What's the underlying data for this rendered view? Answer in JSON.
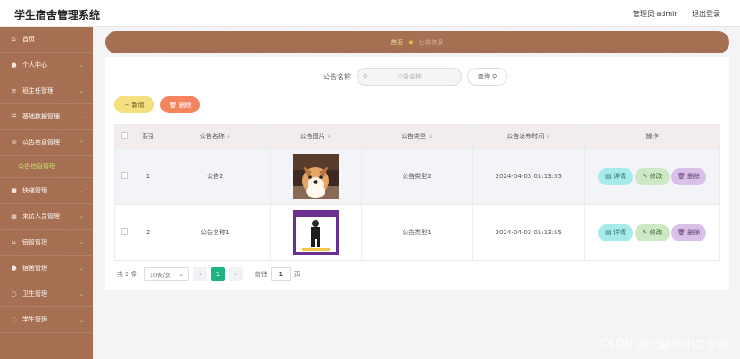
{
  "header": {
    "title": "学生宿舍管理系统",
    "user": "管理员 admin",
    "logout": "退出登录"
  },
  "sidebar": {
    "items": [
      {
        "label": "首页",
        "icon": "home-icon"
      },
      {
        "label": "个人中心",
        "icon": "user-icon"
      },
      {
        "label": "班主任管理",
        "icon": "list-icon"
      },
      {
        "label": "基础数据管理",
        "icon": "menu-icon"
      },
      {
        "label": "公告信息管理",
        "icon": "mail-icon"
      },
      {
        "label": "快递管理",
        "icon": "box-icon"
      },
      {
        "label": "来访人员管理",
        "icon": "grid-icon"
      },
      {
        "label": "宿管管理",
        "icon": "house-icon"
      },
      {
        "label": "宿舍管理",
        "icon": "person-icon"
      },
      {
        "label": "卫生管理",
        "icon": "clean-icon"
      },
      {
        "label": "学生管理",
        "icon": "student-icon"
      }
    ],
    "active_sub": "公告信息管理"
  },
  "breadcrumb": {
    "home": "首页",
    "current": "公告信息"
  },
  "search": {
    "label": "公告名称",
    "placeholder": "公告名称",
    "button": "查询"
  },
  "actions": {
    "add": "新增",
    "delete": "删除"
  },
  "table": {
    "headers": {
      "index": "索引",
      "name": "公告名称",
      "image": "公告图片",
      "type": "公告类型",
      "time": "公告发布时间",
      "ops": "操作"
    },
    "rows": [
      {
        "index": "1",
        "name": "公告2",
        "type": "公告类型2",
        "time": "2024-04-03 01:13:55"
      },
      {
        "index": "2",
        "name": "公告名称1",
        "type": "公告类型1",
        "time": "2024-04-03 01:13:55"
      }
    ],
    "ops": {
      "detail": "详情",
      "edit": "修改",
      "delete": "删除"
    }
  },
  "pagination": {
    "total": "共 2 条",
    "page_size": "10条/页",
    "current": "1",
    "goto": "前往",
    "goto_value": "1",
    "page_unit": "页"
  },
  "watermark": "CSDN @无敌の小さな蚊",
  "colors": {
    "sidebar": "#a56d4f",
    "accent_green": "#1fb37f",
    "add": "#f4e07e",
    "delete": "#f3855e"
  }
}
